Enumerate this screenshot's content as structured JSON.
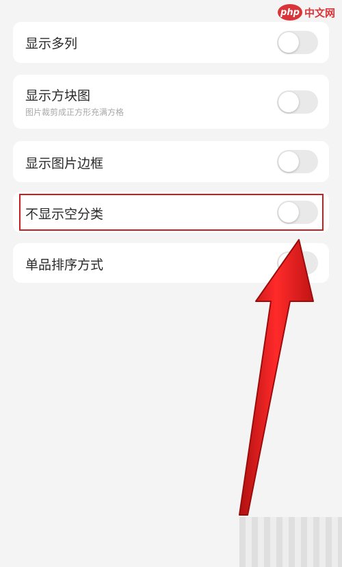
{
  "watermark": {
    "logo_text": "php",
    "site_text": "中文网"
  },
  "settings": [
    {
      "label": "显示多列",
      "enabled": false
    },
    {
      "label": "显示方块图",
      "description": "图片裁剪成正方形充满方格",
      "enabled": false
    },
    {
      "label": "显示图片边框",
      "enabled": false
    },
    {
      "label": "不显示空分类",
      "enabled": false,
      "highlighted": true
    },
    {
      "label": "单品排序方式",
      "enabled": false
    }
  ],
  "annotation": {
    "highlight_color": "#c81e1e",
    "arrow_color": "#e02020"
  }
}
